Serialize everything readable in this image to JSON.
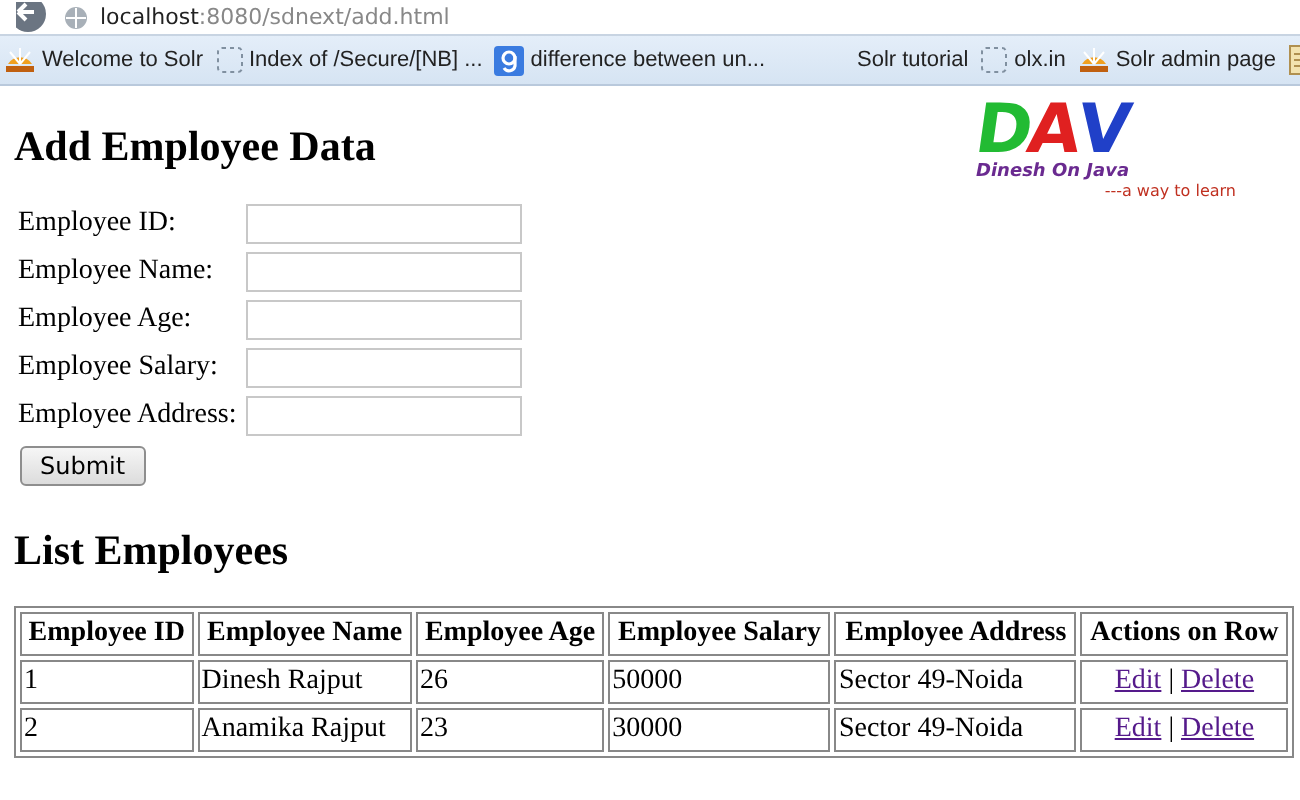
{
  "browser": {
    "url_host": "localhost",
    "url_path": ":8080/sdnext/add.html",
    "bookmarks": [
      {
        "kind": "solr",
        "label": "Welcome to Solr"
      },
      {
        "kind": "blank",
        "label": "Index of /Secure/[NB] ..."
      },
      {
        "kind": "google",
        "label": "difference between un..."
      },
      {
        "kind": "none",
        "label": "Solr tutorial"
      },
      {
        "kind": "blank",
        "label": "olx.in"
      },
      {
        "kind": "solr",
        "label": "Solr admin page"
      },
      {
        "kind": "page"
      }
    ]
  },
  "logo": {
    "letters": [
      {
        "text": "D",
        "color": "#22bb33"
      },
      {
        "text": "A",
        "color": "#e02020"
      },
      {
        "text": "V",
        "color": "#2040c8"
      }
    ],
    "subtitle": "Dinesh On Java",
    "tagline": "---a way to learn"
  },
  "form": {
    "title": "Add Employee Data",
    "fields": [
      {
        "label": "Employee ID:"
      },
      {
        "label": "Employee Name:"
      },
      {
        "label": "Employee Age:"
      },
      {
        "label": "Employee Salary:"
      },
      {
        "label": "Employee Address:"
      }
    ],
    "submit": "Submit"
  },
  "list": {
    "title": "List Employees",
    "columns": [
      "Employee ID",
      "Employee Name",
      "Employee Age",
      "Employee Salary",
      "Employee Address",
      "Actions on Row"
    ],
    "rows": [
      {
        "cells": [
          "1",
          "Dinesh Rajput",
          "26",
          "50000",
          "Sector 49-Noida"
        ],
        "actions": [
          "Edit",
          "|",
          "Delete"
        ]
      },
      {
        "cells": [
          "2",
          "Anamika Rajput",
          "23",
          "30000",
          "Sector 49-Noida"
        ],
        "actions": [
          "Edit",
          "|",
          "Delete"
        ]
      }
    ]
  }
}
